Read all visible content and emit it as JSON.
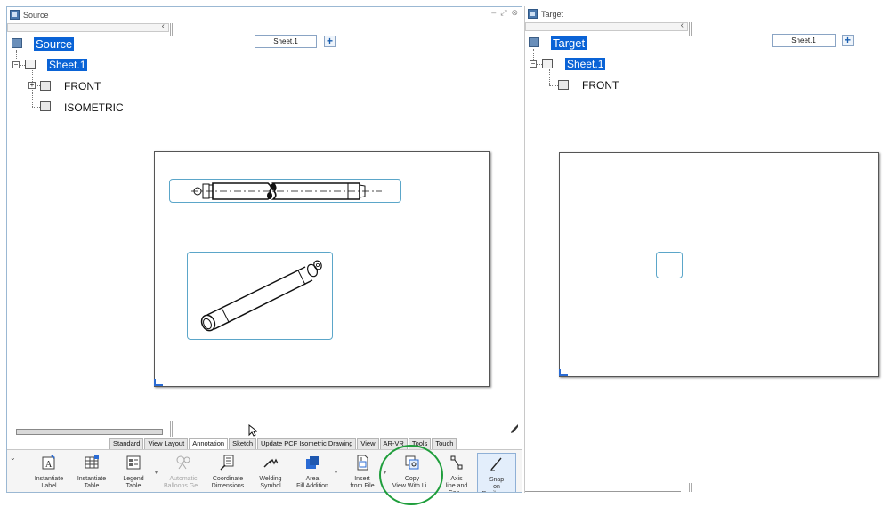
{
  "source": {
    "title": "Source",
    "controls": [
      "–",
      "⤢",
      "⊗"
    ],
    "sheet_selector": "Sheet.1",
    "tree": {
      "root": "Source",
      "sheet": "Sheet.1",
      "views": [
        "FRONT",
        "ISOMETRIC"
      ]
    }
  },
  "target": {
    "title": "Target",
    "sheet_selector": "Sheet.1",
    "tree": {
      "root": "Target",
      "sheet": "Sheet.1",
      "views": [
        "FRONT"
      ]
    }
  },
  "ribbon": {
    "tabs": [
      "Standard",
      "View Layout",
      "Annotation",
      "Sketch",
      "Update PCF Isometric Drawing",
      "View",
      "AR-VR",
      "Tools",
      "Touch"
    ],
    "active_tab": "Annotation",
    "buttons": [
      {
        "line1": "Instantiate",
        "line2": "Label"
      },
      {
        "line1": "Instantiate",
        "line2": "Table"
      },
      {
        "line1": "Legend",
        "line2": "Table"
      },
      {
        "line1": "Automatic",
        "line2": "Balloons Ge..."
      },
      {
        "line1": "Coordinate",
        "line2": "Dimensions"
      },
      {
        "line1": "Welding",
        "line2": "Symbol"
      },
      {
        "line1": "Area",
        "line2": "Fill Addition"
      },
      {
        "line1": "Insert",
        "line2": "from File"
      },
      {
        "line1": "Copy",
        "line2": "View With Li..."
      },
      {
        "line1": "Axis",
        "line2": "line and Cen..."
      },
      {
        "line1": "Snap",
        "line2": "on Privilege..."
      }
    ]
  },
  "colors": {
    "selection": "#0a63d6",
    "frame": "#5ba6c9",
    "highlight_circle": "#1f9e3c"
  }
}
